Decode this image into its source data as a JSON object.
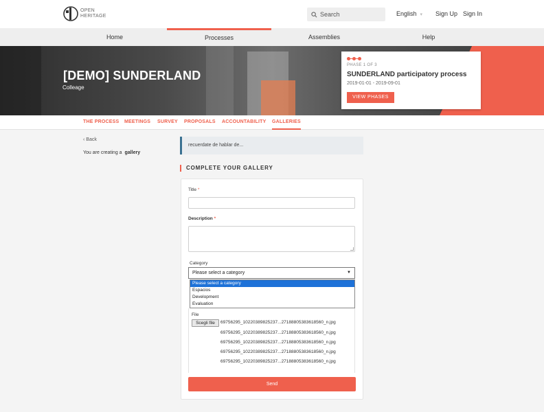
{
  "brand": {
    "logo_text_1": "OPEN",
    "logo_text_2": "HERITAGE",
    "accent": "#ef604d"
  },
  "header": {
    "search_placeholder": "Search",
    "language": "English",
    "sign_up": "Sign Up",
    "sign_in": "Sign In"
  },
  "main_nav": [
    {
      "label": "Home"
    },
    {
      "label": "Processes",
      "active": true
    },
    {
      "label": "Assemblies"
    },
    {
      "label": "Help"
    }
  ],
  "hero": {
    "title": "[DEMO] SUNDERLAND",
    "subtitle": "Colleage",
    "phase": {
      "label": "PHASE 1 OF 3",
      "title": "SUNDERLAND participatory process",
      "dates": "2019-01-01 - 2019-09-01",
      "button": "VIEW PHASES"
    }
  },
  "sub_nav": [
    {
      "label": "THE PROCESS"
    },
    {
      "label": "MEETINGS"
    },
    {
      "label": "SURVEY"
    },
    {
      "label": "PROPOSALS"
    },
    {
      "label": "ACCOUNTABILITY"
    },
    {
      "label": "GALLERIES",
      "active": true
    }
  ],
  "sidebar": {
    "back": "Back",
    "creating_prefix": "You are creating a",
    "creating_item": "gallery"
  },
  "callout": "recuerdate de hablar de...",
  "form": {
    "heading": "COMPLETE YOUR GALLERY",
    "title_label": "Title",
    "title_value": "",
    "description_label": "Description",
    "description_value": "",
    "required_mark": "*",
    "category_label": "Category",
    "category_selected": "Please select a category",
    "category_options": [
      "Please select a category",
      "Espacios",
      "Development",
      "Evaluation"
    ],
    "file_label": "File",
    "file_button": "Scegli file",
    "files": [
      "69756295_10220389825237...27188805383618560_n.jpg",
      "69756295_10220389825237...27188805383618560_n.jpg",
      "69756295_10220389825237...27188805383618560_n.jpg",
      "69756295_10220389825237...27188805383618560_n.jpg",
      "69756295_10220389825237...27188805383618560_n.jpg"
    ],
    "submit": "Send"
  }
}
